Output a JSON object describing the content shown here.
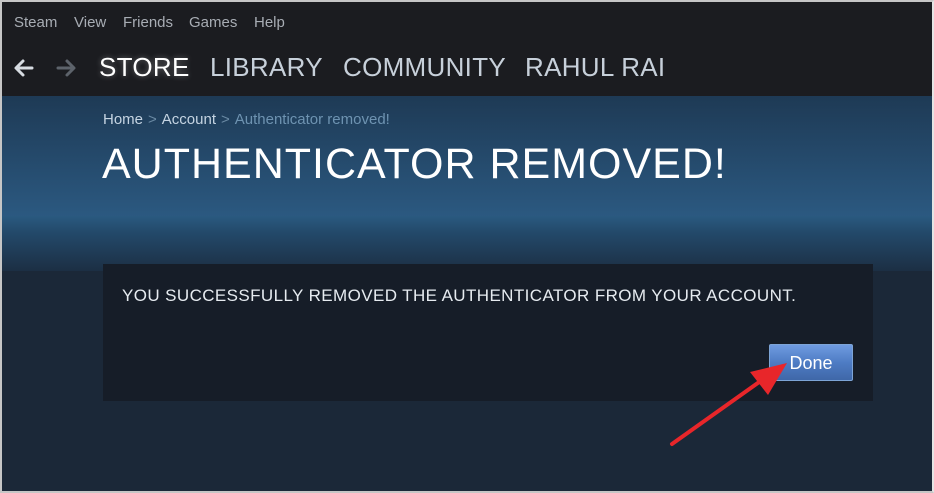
{
  "menubar": {
    "items": [
      "Steam",
      "View",
      "Friends",
      "Games",
      "Help"
    ]
  },
  "navbar": {
    "back_icon": "arrow-left-icon",
    "forward_icon": "arrow-right-icon",
    "links": [
      "STORE",
      "LIBRARY",
      "COMMUNITY",
      "RAHUL RAI"
    ],
    "active": "STORE"
  },
  "breadcrumb": {
    "home": "Home",
    "separator": ">",
    "account": "Account",
    "current": "Authenticator removed!"
  },
  "page": {
    "title": "AUTHENTICATOR REMOVED!"
  },
  "panel": {
    "message": "YOU SUCCESSFULLY REMOVED THE AUTHENTICATOR FROM YOUR ACCOUNT.",
    "done_label": "Done"
  },
  "annotation": {
    "arrow_color": "#e8262a",
    "points_to": "done-button"
  },
  "colors": {
    "background": "#1b2838",
    "topbar": "#1b1c20",
    "accent_button": "#5581c8"
  }
}
